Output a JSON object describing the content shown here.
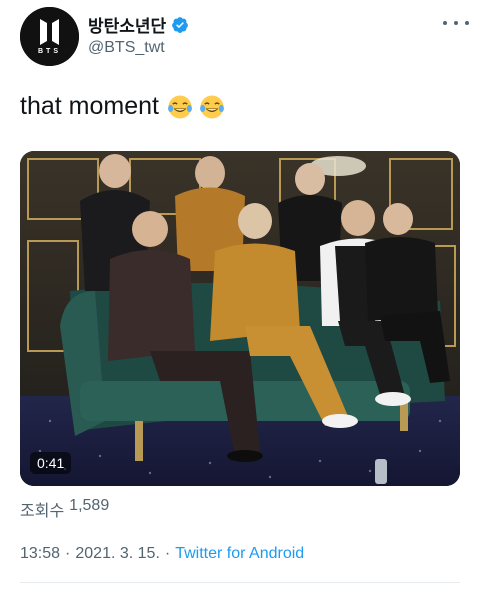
{
  "author": {
    "display_name": "방탄소년단",
    "handle": "@BTS_twt",
    "avatar_text": "BTS",
    "verified": true
  },
  "tweet": {
    "text": "that moment",
    "emoji": [
      "face-with-tears-of-joy",
      "face-with-tears-of-joy"
    ]
  },
  "media": {
    "type": "video",
    "duration": "0:41"
  },
  "stats": {
    "views_label": "조회수",
    "views_count": "1,589"
  },
  "meta": {
    "time": "13:58",
    "separator": "·",
    "date": "2021. 3. 15.",
    "source": "Twitter for Android"
  },
  "colors": {
    "text": "#0f1419",
    "secondary": "#536471",
    "link": "#1d9bf0",
    "verified": "#1d9bf0"
  }
}
